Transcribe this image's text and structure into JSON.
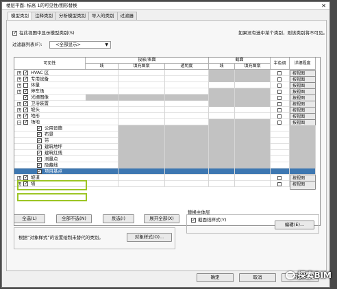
{
  "window": {
    "title": "楼层平面: 标高 1的可见性/图形替换",
    "close": "✕"
  },
  "tabs": [
    "模型类别",
    "注释类别",
    "分析模型类别",
    "导入的类别",
    "过滤器"
  ],
  "show_model_checkbox": {
    "label": "在此视图中显示模型类别(S)",
    "checked": true
  },
  "hint": "如果没有选中某个类别，则该类别将不可见。",
  "filter": {
    "label": "过滤器列表(F):",
    "value": "<全部显示>"
  },
  "table": {
    "col_visibility": "可见性",
    "group_projection": "投影/表面",
    "group_cut": "截面",
    "col_halftone": "半色调",
    "col_detail": "详细程度",
    "sub_line": "线",
    "sub_fill": "填充图案",
    "sub_transparency": "透明度",
    "sub_cut_line": "线",
    "sub_cut_fill": "填充图案",
    "rows": [
      {
        "label": "HVAC 区",
        "level": 0,
        "expand": "+",
        "checked": true,
        "cut_gray": true,
        "detail": "按视图"
      },
      {
        "label": "专用设备",
        "level": 0,
        "expand": "+",
        "checked": true,
        "cut_gray": true,
        "detail": "按视图"
      },
      {
        "label": "体量",
        "level": 0,
        "expand": "+",
        "checked": false,
        "cut_gray": false,
        "detail": "按视图"
      },
      {
        "label": "停车场",
        "level": 0,
        "expand": "+",
        "checked": true,
        "cut_gray": true,
        "detail": "按视图"
      },
      {
        "label": "光栅图像",
        "level": 0,
        "expand": "",
        "checked": true,
        "all_gray": true,
        "detail": "按视图"
      },
      {
        "label": "卫浴装置",
        "level": 0,
        "expand": "+",
        "checked": true,
        "cut_gray": true,
        "detail": "按视图"
      },
      {
        "label": "坡头",
        "level": 0,
        "expand": "+",
        "checked": true,
        "cut_gray": false,
        "detail": "按视图"
      },
      {
        "label": "地形",
        "level": 0,
        "expand": "+",
        "checked": true,
        "cut_gray": false,
        "detail": "按视图"
      },
      {
        "label": "场地",
        "level": 0,
        "expand": "−",
        "checked": true,
        "cut_gray": true,
        "detail": "按视图"
      },
      {
        "label": "公用设施",
        "level": 1,
        "checked": true,
        "sub": true
      },
      {
        "label": "布景",
        "level": 1,
        "checked": true,
        "sub": true
      },
      {
        "label": "带",
        "level": 1,
        "checked": true,
        "sub": true
      },
      {
        "label": "建筑地坪",
        "level": 1,
        "checked": true,
        "sub": true
      },
      {
        "label": "建筑红线",
        "level": 1,
        "checked": true,
        "sub": true
      },
      {
        "label": "测量点",
        "level": 1,
        "checked": true,
        "sub": true
      },
      {
        "label": "隐藏线",
        "level": 1,
        "checked": true,
        "sub": true
      },
      {
        "label": "项目基点",
        "level": 1,
        "checked": true,
        "sub": true,
        "selected": true
      },
      {
        "label": "坡道",
        "level": 0,
        "expand": "+",
        "checked": true,
        "cut_gray": false,
        "detail": "按视图"
      },
      {
        "label": "墙",
        "level": 0,
        "expand": "+",
        "checked": true,
        "cut_gray": false,
        "detail": "按视图"
      }
    ]
  },
  "buttons": {
    "select_all": "全选(L)",
    "select_none": "全部不选(N)",
    "invert": "反选(I)",
    "expand_all": "展开全部(X)",
    "object_styles": "对象样式(O)...",
    "edit": "编辑(E)...",
    "ok": "确定",
    "cancel": "取消",
    "apply": "应用(A)"
  },
  "object_style_hint": "根据“对象样式”的设置绘制未替代的类别。",
  "host": {
    "group_label": "替换主体层",
    "cut_line_label": "截面线样式(Y)",
    "checked": true
  },
  "watermark": "探索BIM"
}
